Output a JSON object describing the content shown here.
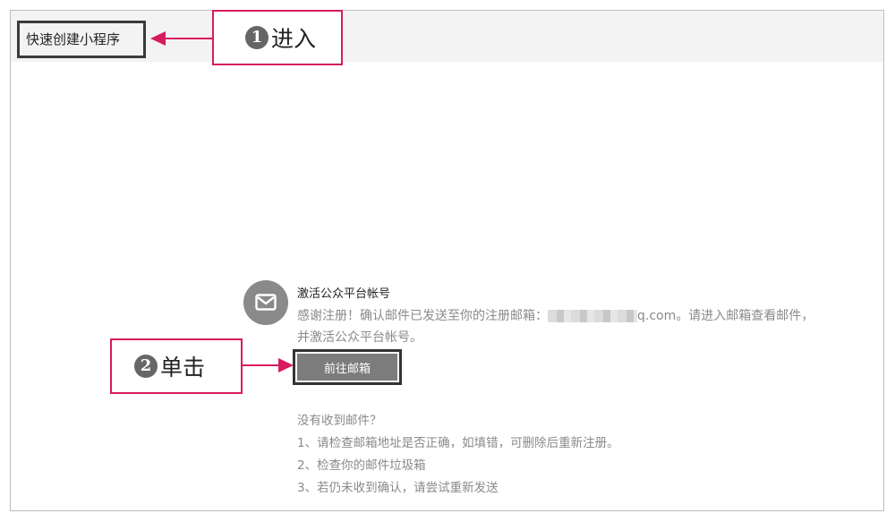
{
  "header": {
    "quick_create_label": "快速创建小程序"
  },
  "callouts": [
    {
      "number": "1",
      "text": "进入"
    },
    {
      "number": "2",
      "text": "单击"
    }
  ],
  "activation": {
    "title": "激活公众平台帐号",
    "desc_line1_prefix": "感谢注册！确认邮件已发送至你的注册邮箱：",
    "desc_line1_suffix": "q.com。请进入邮箱查看邮件，",
    "desc_line2": "并激活公众平台帐号。",
    "button_label": "前往邮箱"
  },
  "help": {
    "question": "没有收到邮件？",
    "items": [
      "1、请检查邮箱地址是否正确，如填错，可删除后重新注册。",
      "2、检查你的邮件垃圾箱",
      "3、若仍未收到确认，请尝试重新发送"
    ]
  },
  "icons": {
    "mail": "mail-icon"
  },
  "colors": {
    "annotation": "#d81b60",
    "button_bg": "#7c7c7c",
    "topbar_bg": "#f3f3f3"
  }
}
